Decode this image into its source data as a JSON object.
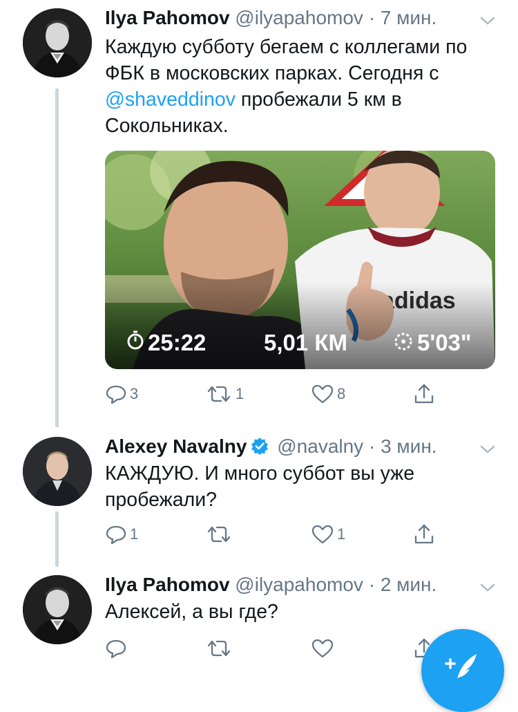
{
  "tweets": [
    {
      "name": "Ilya Pahomov",
      "handle": "@ilyapahomov",
      "time": "7 мин.",
      "text_part1": "Каждую субботу бегаем с коллегами по ФБК в московских парках. Сегодня с ",
      "mention": "@shaveddinov",
      "text_part2": " пробежали 5 км в Сокольниках.",
      "media": {
        "duration": "25:22",
        "distance": "5,01 КМ",
        "pace": "5'03\"",
        "shirt_text": "adidas"
      },
      "replies": "3",
      "retweets": "1",
      "likes": "8"
    },
    {
      "name": "Alexey Navalny",
      "handle": "@navalny",
      "time": "3 мин.",
      "text": "КАЖДУЮ. И много суббот вы уже пробежали?",
      "replies": "1",
      "retweets": "",
      "likes": "1"
    },
    {
      "name": "Ilya Pahomov",
      "handle": "@ilyapahomov",
      "time": "2 мин.",
      "text": "Алексей, а вы где?",
      "replies": "",
      "retweets": "",
      "likes": ""
    }
  ],
  "separator": "·",
  "colors": {
    "accent": "#1da1f2",
    "muted": "#657786",
    "text": "#14171a",
    "thread": "#ccd6dd"
  },
  "icons": [
    "reply-icon",
    "retweet-icon",
    "like-icon",
    "share-icon",
    "chevron-down-icon",
    "verified-icon",
    "compose-icon"
  ]
}
